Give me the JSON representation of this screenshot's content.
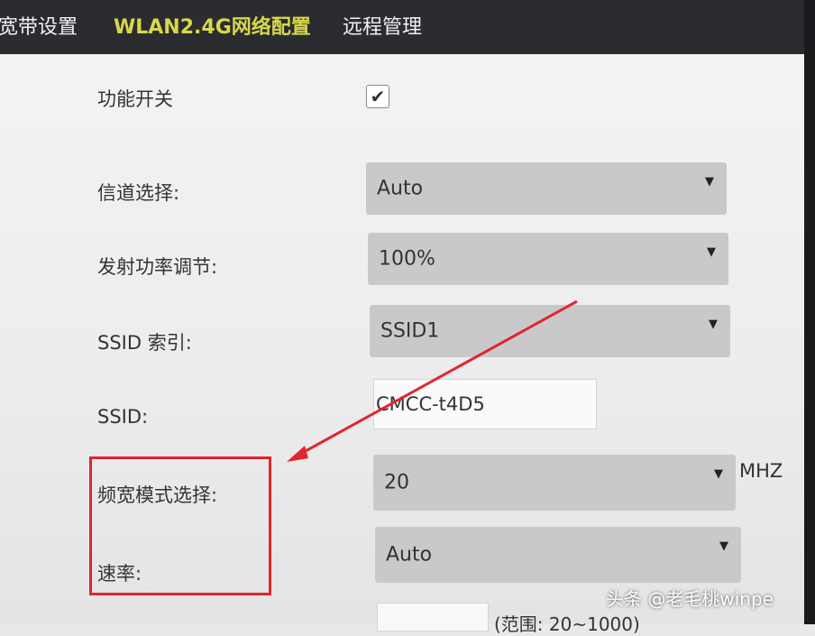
{
  "tabs": [
    {
      "label": "宽带设置",
      "active": false
    },
    {
      "label": "WLAN2.4G网络配置",
      "active": true
    },
    {
      "label": "远程管理",
      "active": false
    }
  ],
  "form": {
    "enable_label": "功能开关",
    "enable_checked": true,
    "channel_label": "信道选择:",
    "channel_value": "Auto",
    "power_label": "发射功率调节:",
    "power_value": "100%",
    "ssid_index_label": "SSID 索引:",
    "ssid_index_value": "SSID1",
    "ssid_label": "SSID:",
    "ssid_value": "CMCC-t4D5",
    "bandwidth_label": "频宽模式选择:",
    "bandwidth_value": "20",
    "bandwidth_unit": "MHZ",
    "rate_label": "速率:",
    "rate_value": "Auto",
    "partial_text": "(范围: 20~1000)"
  },
  "icons": {
    "dropdown": "caret-down-icon",
    "check": "checkmark-icon"
  },
  "colors": {
    "highlight": "#e0262e",
    "active_tab": "#d8d84a",
    "topbar": "#2b2c30"
  },
  "watermark": "头条 @老毛桃winpe"
}
